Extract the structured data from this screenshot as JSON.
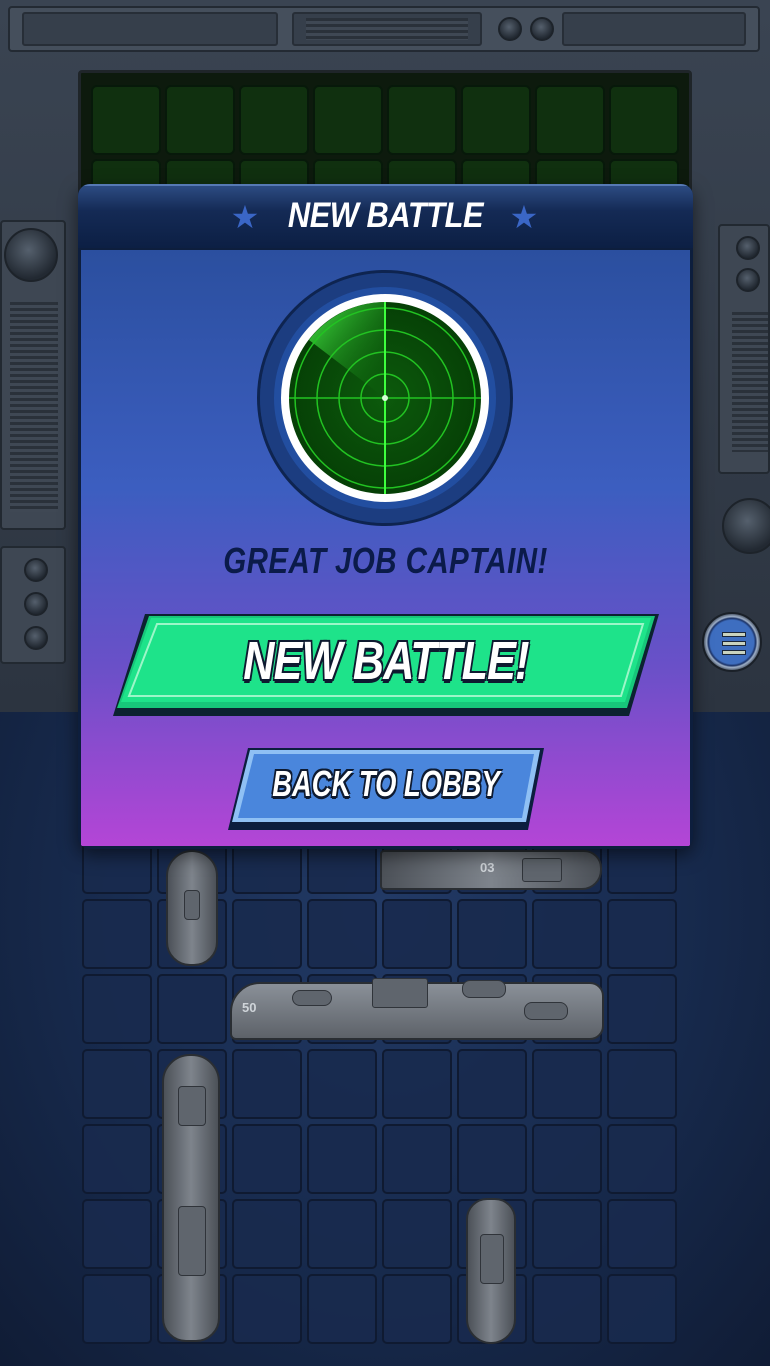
{
  "dialog": {
    "title": "NEW BATTLE",
    "status": "GREAT JOB CAPTAIN!",
    "primary_button_label": "NEW BATTLE!",
    "secondary_button_label": "BACK TO LOBBY"
  },
  "ships": {
    "carrier_number": "50",
    "destroyer_number": "03"
  },
  "icons": {
    "header_star": "star-icon",
    "radar": "radar-icon",
    "menu": "hamburger-menu-icon"
  },
  "colors": {
    "primary_button": "#1ee38a",
    "secondary_button": "#4a86dc",
    "radar_green": "#1ddc1d",
    "dialog_top": "#2b4f9f",
    "dialog_bottom": "#b445d6"
  }
}
